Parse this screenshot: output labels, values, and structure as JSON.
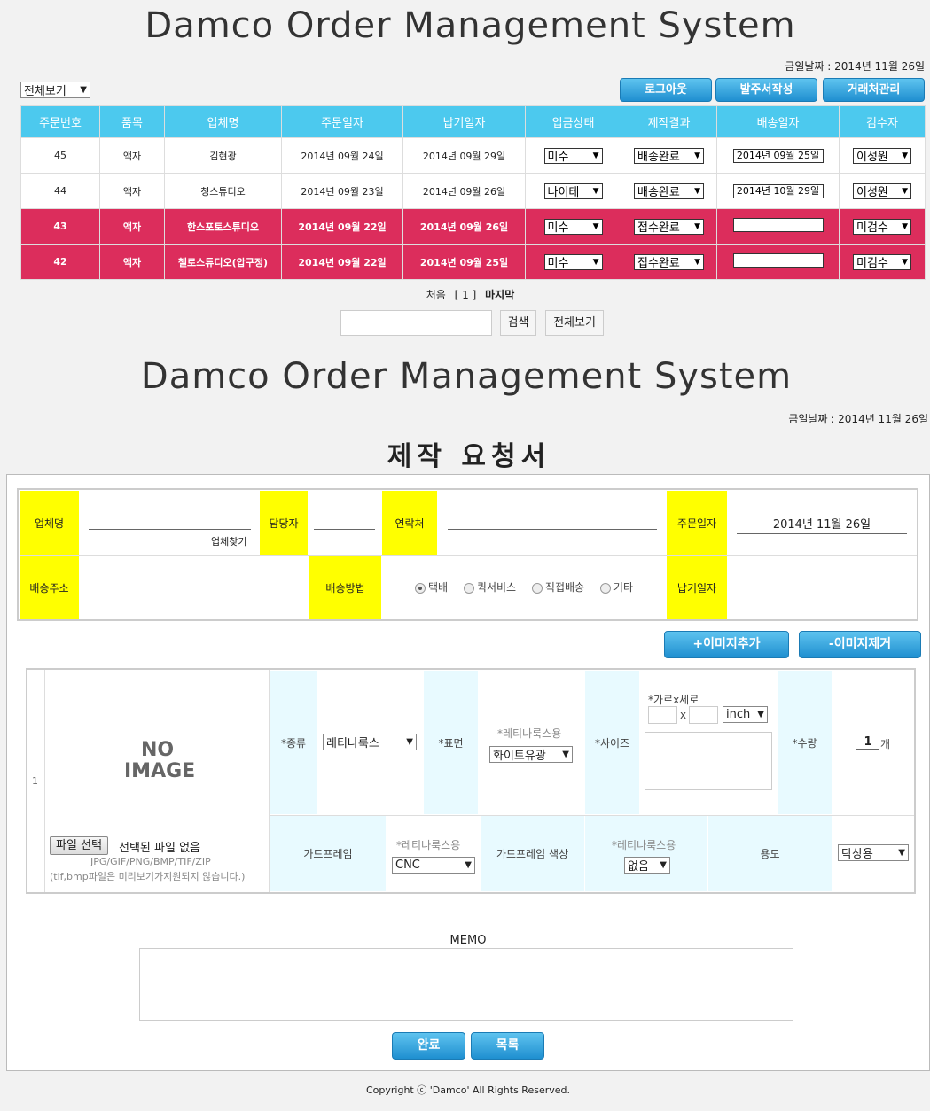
{
  "header": {
    "title": "Damco Order Management System",
    "date_label": "금일날짜 : 2014년 11월 26일"
  },
  "list": {
    "filter_select": "전체보기",
    "buttons": {
      "logout": "로그아웃",
      "order_form": "발주서작성",
      "clients": "거래처관리"
    },
    "columns": [
      "주문번호",
      "품목",
      "업체명",
      "주문일자",
      "납기일자",
      "입금상태",
      "제작결과",
      "배송일자",
      "검수자"
    ],
    "rows": [
      {
        "no": "45",
        "item": "액자",
        "company": "김현광",
        "order_date": "2014년 09월 24일",
        "due_date": "2014년 09월 29일",
        "payment": "미수",
        "result": "배송완료",
        "ship_date": "2014년 09월 25일",
        "inspector": "이성원",
        "highlight": false
      },
      {
        "no": "44",
        "item": "액자",
        "company": "청스튜디오",
        "order_date": "2014년 09월 23일",
        "due_date": "2014년 09월 26일",
        "payment": "나이테",
        "result": "배송완료",
        "ship_date": "2014년 10월 29일",
        "inspector": "이성원",
        "highlight": false
      },
      {
        "no": "43",
        "item": "액자",
        "company": "한스포토스튜디오",
        "order_date": "2014년 09월 22일",
        "due_date": "2014년 09월 26일",
        "payment": "미수",
        "result": "접수완료",
        "ship_date": "",
        "inspector": "미검수",
        "highlight": true
      },
      {
        "no": "42",
        "item": "액자",
        "company": "첼로스튜디오(압구정)",
        "order_date": "2014년 09월 22일",
        "due_date": "2014년 09월 25일",
        "payment": "미수",
        "result": "접수완료",
        "ship_date": "",
        "inspector": "미검수",
        "highlight": true
      }
    ],
    "pager": {
      "first": "처음",
      "page": "[ 1 ]",
      "last": "마지막"
    },
    "search": {
      "value": "",
      "search_button": "검색",
      "view_all_button": "전체보기"
    }
  },
  "form": {
    "title": "Damco Order Management System",
    "date_label": "금일날짜 : 2014년 11월 26일",
    "heading": "제작 요청서",
    "labels": {
      "company": "업체명",
      "manager": "담당자",
      "contact": "연락처",
      "order_date": "주문일자",
      "address": "배송주소",
      "ship_method": "배송방법",
      "due_date": "납기일자"
    },
    "find_company": "업체찾기",
    "order_date_value": "2014년 11월 26일",
    "ship_methods": [
      "택배",
      "퀵서비스",
      "직접배송",
      "기타"
    ],
    "add_image_button": "+이미지추가",
    "remove_image_button": "-이미지제거",
    "item": {
      "index": "1",
      "no_image_line1": "NO",
      "no_image_line2": "IMAGE",
      "file_button": "파일 선택",
      "file_status": "선택된 파일 없음",
      "file_types": "JPG/GIF/PNG/BMP/TIF/ZIP",
      "file_note": "(tif,bmp파일은 미리보기가지원되지 않습니다.)",
      "type_label": "*종류",
      "type_value": "레티나룩스",
      "surface_label": "*표면",
      "surface_note": "*레티나룩스용",
      "surface_value": "화이트유광",
      "size_label": "*사이즈",
      "size_hint": "*가로x세로",
      "size_x": "x",
      "size_unit": "inch",
      "qty_label": "*수량",
      "qty_value": "1",
      "qty_unit": "개",
      "guide_frame": "가드프레임",
      "guide_note": "*레티나룩스용",
      "guide_value": "CNC",
      "guide_color": "가드프레임 색상",
      "color_note": "*레티나룩스용",
      "color_value": "없음",
      "usage_label": "용도",
      "usage_value": "탁상용"
    },
    "memo_label": "MEMO",
    "done_button": "완료",
    "list_button": "목록"
  },
  "footer": {
    "copyright": "Copyright ⓒ 'Damco' All Rights Reserved."
  }
}
